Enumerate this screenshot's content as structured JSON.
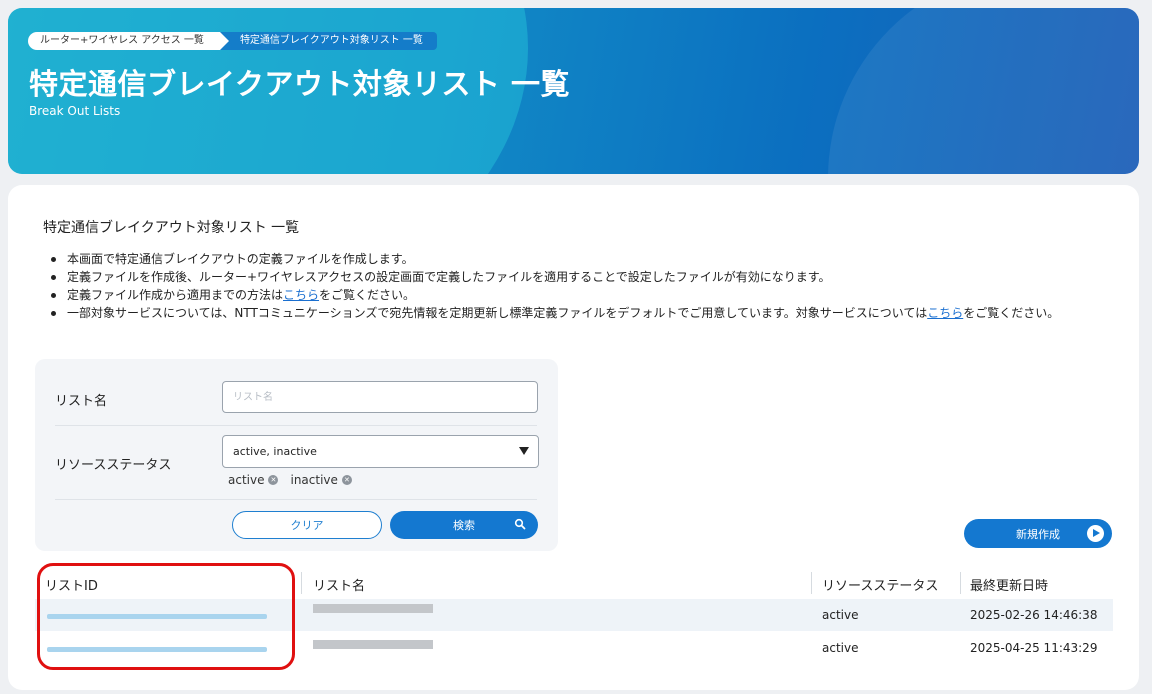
{
  "header": {
    "breadcrumbs": [
      "ルーター+ワイヤレス アクセス 一覧",
      "特定通信ブレイクアウト対象リスト 一覧"
    ],
    "title": "特定通信ブレイクアウト対象リスト 一覧",
    "subtitle": "Break Out Lists"
  },
  "section": {
    "title": "特定通信ブレイクアウト対象リスト 一覧",
    "bullets": {
      "b1": "本画面で特定通信ブレイクアウトの定義ファイルを作成します。",
      "b2": "定義ファイルを作成後、ルーター+ワイヤレスアクセスの設定画面で定義したファイルを適用することで設定したファイルが有効になります。",
      "b3_pre": "定義ファイル作成から適用までの方法は",
      "b3_link": "こちら",
      "b3_post": "をご覧ください。",
      "b4_pre": "一部対象サービスについては、NTTコミュニケーションズで宛先情報を定期更新し標準定義ファイルをデフォルトでご用意しています。対象サービスについては",
      "b4_link": "こちら",
      "b4_post": "をご覧ください。"
    }
  },
  "filter": {
    "list_name_label": "リスト名",
    "list_name_placeholder": "リスト名",
    "status_label": "リソースステータス",
    "status_value": "active, inactive",
    "chips": [
      "active",
      "inactive"
    ],
    "clear_label": "クリア",
    "search_label": "検索"
  },
  "actions": {
    "new_label": "新規作成"
  },
  "table": {
    "headers": [
      "リストID",
      "リスト名",
      "リソースステータス",
      "最終更新日時"
    ],
    "rows": [
      {
        "status": "active",
        "updated": "2025-02-26 14:46:38"
      },
      {
        "status": "active",
        "updated": "2025-04-25 11:43:29"
      }
    ]
  },
  "colors": {
    "primary": "#1478d0",
    "highlight": "#e01010",
    "link": "#1a6fd0"
  },
  "icons": [
    "search-icon",
    "arrow-circle-icon",
    "remove-chip-icon"
  ]
}
